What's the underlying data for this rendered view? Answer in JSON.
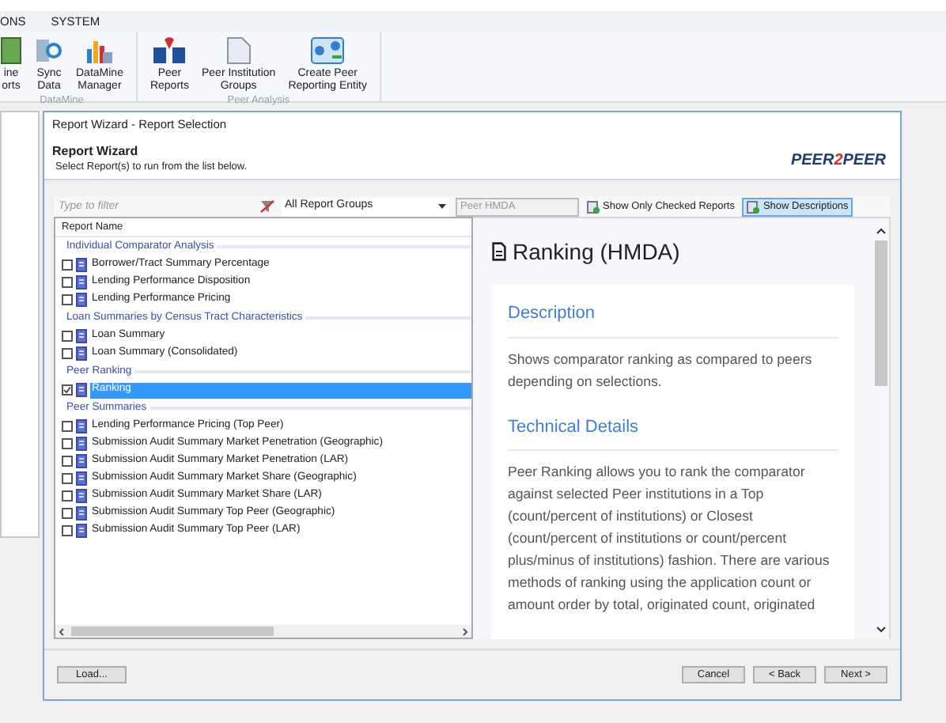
{
  "menu_tabs": [
    {
      "label": "ONS"
    },
    {
      "label": "SYSTEM"
    }
  ],
  "ribbon_groups": [
    {
      "label": "DataMine",
      "buttons": [
        {
          "label": "ine\norts",
          "kind": "sheet"
        },
        {
          "label": "Sync\nData",
          "kind": "sync"
        },
        {
          "label": "DataMine\nManager",
          "kind": "chart"
        }
      ]
    },
    {
      "label": "Peer Analysis",
      "buttons": [
        {
          "label": "Peer\nReports",
          "kind": "p2p"
        },
        {
          "label": "Peer Institution\nGroups",
          "kind": "doc"
        },
        {
          "label": "Create Peer\nReporting Entity",
          "kind": "network"
        }
      ]
    }
  ],
  "dialog": {
    "title": "Report Wizard - Report Selection",
    "header": {
      "title": "Report Wizard",
      "subtitle": "Select Report(s) to run from the list below."
    },
    "logo": [
      "PEER",
      "2",
      "PEER"
    ],
    "toolbar": {
      "filter_placeholder": "Type to filter",
      "group_dropdown": "All Report Groups",
      "peer_dropdown": {
        "value": "Peer HMDA",
        "disabled": true
      },
      "toggles": [
        {
          "label": "Show Only Checked Reports",
          "selected": false
        },
        {
          "label": "Show Descriptions",
          "selected": true
        }
      ]
    },
    "report_list": {
      "column": "Report Name",
      "groups": [
        {
          "label": "Individual Comparator Analysis",
          "items": [
            {
              "label": "Borrower/Tract Summary Percentage",
              "checked": false,
              "selected": false
            },
            {
              "label": "Lending Performance Disposition",
              "checked": false,
              "selected": false
            },
            {
              "label": "Lending Performance Pricing",
              "checked": false,
              "selected": false
            }
          ]
        },
        {
          "label": "Loan Summaries by Census Tract Characteristics",
          "items": [
            {
              "label": "Loan Summary",
              "checked": false,
              "selected": false
            },
            {
              "label": "Loan Summary (Consolidated)",
              "checked": false,
              "selected": false
            }
          ]
        },
        {
          "label": "Peer Ranking",
          "items": [
            {
              "label": "Ranking",
              "checked": true,
              "selected": true
            }
          ]
        },
        {
          "label": "Peer Summaries",
          "items": [
            {
              "label": "Lending Performance Pricing (Top Peer)",
              "checked": false,
              "selected": false
            },
            {
              "label": "Submission Audit Summary Market Penetration (Geographic)",
              "checked": false,
              "selected": false
            },
            {
              "label": "Submission Audit Summary Market Penetration (LAR)",
              "checked": false,
              "selected": false
            },
            {
              "label": "Submission Audit Summary Market Share (Geographic)",
              "checked": false,
              "selected": false
            },
            {
              "label": "Submission Audit Summary Market Share (LAR)",
              "checked": false,
              "selected": false
            },
            {
              "label": "Submission Audit Summary Top Peer (Geographic)",
              "checked": false,
              "selected": false
            },
            {
              "label": "Submission Audit Summary Top Peer (LAR)",
              "checked": false,
              "selected": false
            }
          ]
        }
      ]
    },
    "description": {
      "title": "Ranking (HMDA)",
      "sections": [
        {
          "heading": "Description",
          "text": "Shows comparator ranking as compared to peers depending on selections."
        },
        {
          "heading": "Technical Details",
          "text": "Peer Ranking allows you to rank the comparator against selected Peer institutions in a Top (count/percent of institutions) or Closest (count/percent of institutions or count/percent plus/minus of institutions) fashion. There are various methods of ranking using the application count or amount order by total, originated count, originated"
        }
      ]
    },
    "buttons": {
      "load": "Load...",
      "nav": [
        "Cancel",
        "< Back",
        "Next >"
      ]
    }
  }
}
